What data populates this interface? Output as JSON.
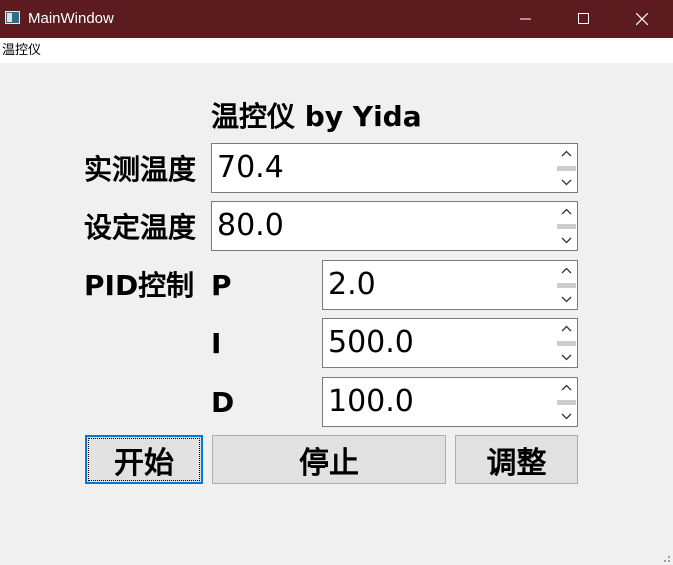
{
  "window": {
    "title": "MainWindow",
    "title_bar_color": "#5b1b1f"
  },
  "menubar": {
    "items": [
      {
        "label": "温控仪"
      }
    ]
  },
  "main": {
    "heading": "温控仪 by Yida",
    "measured_temp": {
      "label": "实测温度",
      "value": "70.4"
    },
    "set_temp": {
      "label": "设定温度",
      "value": "80.0"
    },
    "pid": {
      "label": "PID控制",
      "p": {
        "label": "P",
        "value": "2.0"
      },
      "i": {
        "label": "I",
        "value": "500.0"
      },
      "d": {
        "label": "D",
        "value": "100.0"
      }
    }
  },
  "buttons": {
    "start": "开始",
    "stop": "停止",
    "adjust": "调整"
  },
  "icons": {
    "app": "app-icon",
    "minimize": "minimize-icon",
    "maximize": "maximize-icon",
    "close": "close-icon",
    "spin_up": "chevron-up-icon",
    "spin_down": "chevron-down-icon"
  }
}
